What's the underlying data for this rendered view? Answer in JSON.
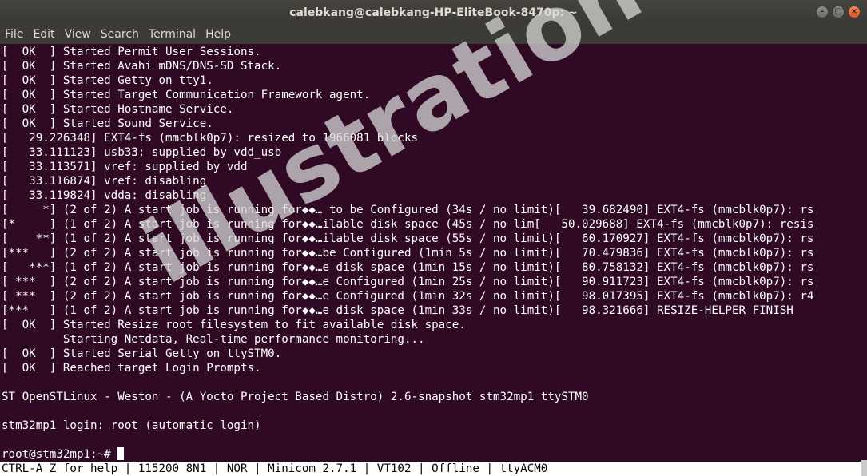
{
  "window": {
    "title": "calebkang@calebkang-HP-EliteBook-8470p: ~",
    "controls": {
      "minimize": "–",
      "maximize": "□",
      "close": "×"
    }
  },
  "menu": [
    "File",
    "Edit",
    "View",
    "Search",
    "Terminal",
    "Help"
  ],
  "terminal": {
    "lines": [
      "[  OK  ] Started Permit User Sessions.",
      "[  OK  ] Started Avahi mDNS/DNS-SD Stack.",
      "[  OK  ] Started Getty on tty1.",
      "[  OK  ] Started Target Communication Framework agent.",
      "[  OK  ] Started Hostname Service.",
      "[  OK  ] Started Sound Service.",
      "[   29.226348] EXT4-fs (mmcblk0p7): resized to 1966081 blocks",
      "[   33.111123] usb33: supplied by vdd_usb",
      "[   33.113571] vref: supplied by vdd",
      "[   33.116874] vref: disabling",
      "[   33.119824] vdda: disabling",
      "[     *] (2 of 2) A start job is running for◆◆… to be Configured (34s / no limit)[   39.682490] EXT4-fs (mmcblk0p7): rs",
      "[*     ] (1 of 2) A start job is running for◆◆…ilable disk space (45s / no lim[   50.029688] EXT4-fs (mmcblk0p7): resis",
      "[    **] (1 of 2) A start job is running for◆◆…ilable disk space (55s / no limit)[   60.170927] EXT4-fs (mmcblk0p7): rs",
      "[***   ] (2 of 2) A start job is running for◆◆…be Configured (1min 5s / no limit)[   70.479836] EXT4-fs (mmcblk0p7): rs",
      "[   ***] (1 of 2) A start job is running for◆◆…e disk space (1min 15s / no limit)[   80.758132] EXT4-fs (mmcblk0p7): rs",
      "[ ***  ] (2 of 2) A start job is running for◆◆…e Configured (1min 25s / no limit)[   90.911723] EXT4-fs (mmcblk0p7): rs",
      "[ ***  ] (2 of 2) A start job is running for◆◆…e Configured (1min 32s / no limit)[   98.017395] EXT4-fs (mmcblk0p7): r4",
      "[***   ] (1 of 2) A start job is running for◆◆…e disk space (1min 33s / no limit)[   98.321666] RESIZE-HELPER FINISH",
      "[  OK  ] Started Resize root filesystem to fit available disk space.",
      "         Starting Netdata, Real-time performance monitoring...",
      "[  OK  ] Started Serial Getty on ttySTM0.",
      "[  OK  ] Reached target Login Prompts.",
      "",
      "ST OpenSTLinux - Weston - (A Yocto Project Based Distro) 2.6-snapshot stm32mp1 ttySTM0",
      "",
      "stm32mp1 login: root (automatic login)",
      ""
    ],
    "prompt": "root@stm32mp1:~# "
  },
  "status_bar": "CTRL-A Z for help | 115200 8N1 | NOR | Minicom 2.7.1 | VT102 | Offline | ttyACM0",
  "watermark": "illustration"
}
